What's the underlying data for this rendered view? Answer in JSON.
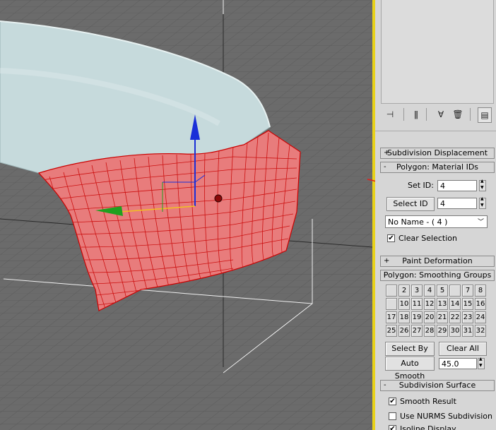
{
  "viewport": {
    "colors": {
      "background": "#6b6b6b",
      "grid": "#5a5a5a",
      "mesh_fill": "#e87878",
      "mesh_wire": "#cc0000",
      "body_top": "#c6dadc",
      "gizmo_z": "#1a2fd8",
      "gizmo_x": "#1fa01f",
      "annotation": "#e0201c"
    }
  },
  "panel": {
    "toolbar": {
      "icons": [
        "pin-stack-icon",
        "show-end-result-icon",
        "make-unique-icon",
        "remove-modifier-icon",
        "configure-sets-icon"
      ]
    },
    "rollouts": {
      "subdivision_displacement": {
        "sign": "+",
        "title": "Subdivision Displacement"
      },
      "material_ids": {
        "sign": "-",
        "title": "Polygon: Material IDs",
        "set_id_label": "Set ID:",
        "set_id_value": "4",
        "select_id_label": "Select ID",
        "select_id_value": "4",
        "name_dropdown": "No Name - ( 4 )",
        "clear_selection_label": "Clear Selection",
        "clear_selection_checked": "✔"
      },
      "paint_deformation": {
        "sign": "+",
        "title": "Paint Deformation"
      },
      "smoothing_groups": {
        "sign": "-",
        "title": "Polygon: Smoothing Groups",
        "buttons": [
          "",
          "2",
          "3",
          "4",
          "5",
          "",
          "7",
          "8",
          "",
          "10",
          "11",
          "12",
          "13",
          "14",
          "15",
          "16",
          "17",
          "18",
          "19",
          "20",
          "21",
          "22",
          "23",
          "24",
          "25",
          "26",
          "27",
          "28",
          "29",
          "30",
          "31",
          "32"
        ],
        "select_by_sg_label": "Select By SG",
        "clear_all_label": "Clear All",
        "auto_smooth_label": "Auto Smooth",
        "auto_smooth_value": "45.0"
      },
      "subdivision_surface": {
        "sign": "-",
        "title": "Subdivision Surface",
        "smooth_result_label": "Smooth Result",
        "smooth_result_checked": "✔",
        "use_nurms_label": "Use NURMS Subdivision",
        "use_nurms_checked": "",
        "isoline_label": "Isoline Display",
        "isoline_checked": "✔"
      }
    }
  }
}
